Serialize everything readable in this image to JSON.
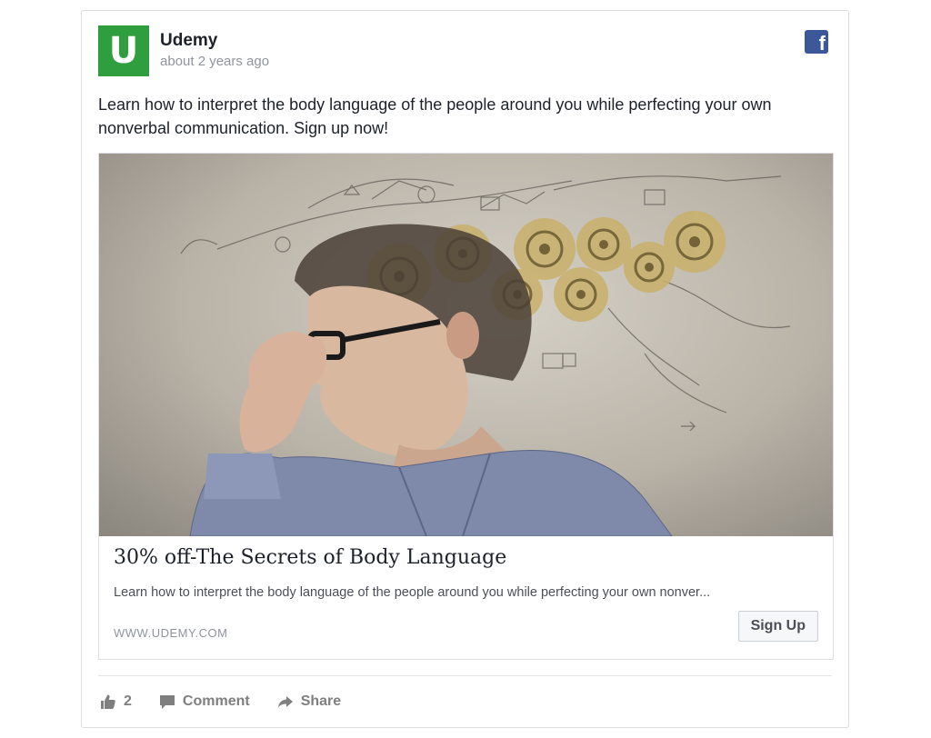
{
  "post": {
    "page_name": "Udemy",
    "avatar_letter": "U",
    "timestamp": "about 2 years ago",
    "platform_icon": "facebook-icon",
    "platform_glyph": "f",
    "text": "Learn how to interpret the body language of the people around you while perfecting your own nonverbal communication. Sign up now!"
  },
  "link": {
    "image_description_icon": "photo",
    "title": "30% off-The Secrets of Body Language",
    "description": "Learn how to interpret the body language of the people around you while perfecting your own nonver...",
    "domain": "WWW.UDEMY.COM",
    "cta_label": "Sign Up"
  },
  "actions": {
    "like_count": "2",
    "comment_label": "Comment",
    "share_label": "Share"
  },
  "colors": {
    "brand_green": "#2e9e3e",
    "facebook_blue": "#3b5998",
    "text_primary": "#1d2129",
    "text_secondary": "#90949c"
  }
}
